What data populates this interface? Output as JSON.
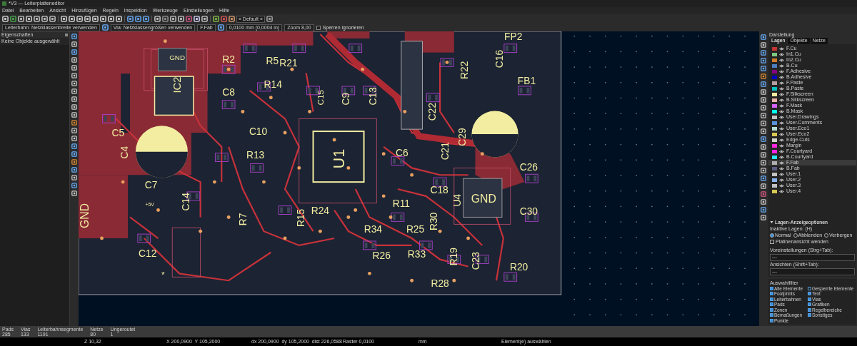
{
  "window": {
    "title": "*V3 — Leiterplatteneditor"
  },
  "menu": [
    "Datei",
    "Bearbeiten",
    "Ansicht",
    "Hinzufügen",
    "Regeln",
    "Inspektion",
    "Werkzeuge",
    "Einstellungen",
    "Hilfe"
  ],
  "toolbar": {
    "preset": "« Default »"
  },
  "toolbar2": {
    "track_width": "Leiterbahn: Netzklassenbreite verwenden",
    "via_size": "Via: Netzklassengrößen verwenden",
    "layer": "F.Fab",
    "grid": "0,0100 mm (0,0004 in)",
    "zoom": "Zoom 8,00",
    "ignore_locks": {
      "label": "Sperren ignorieren",
      "checked": false
    }
  },
  "properties_panel": {
    "title": "Eigenschaften",
    "message": "Keine Objekte ausgewählt"
  },
  "board": {
    "labels": [
      "GND",
      "R2",
      "R5",
      "R21",
      "IC2",
      "R14",
      "C8",
      "C5",
      "C4",
      "C7",
      "C10",
      "R13",
      "C14",
      "+5V",
      "C12",
      "R7",
      "R15",
      "R24",
      "U1",
      "C15",
      "C9",
      "C13",
      "R22",
      "C22",
      "C16",
      "FP2",
      "FB1",
      "C21",
      "C29",
      "C6",
      "C26",
      "C18",
      "R11",
      "U4",
      "GND",
      "C30",
      "R30",
      "R34",
      "R25",
      "R26",
      "R33",
      "R19",
      "C23",
      "R20",
      "R28",
      "GND",
      "*"
    ]
  },
  "appearance_panel": {
    "title": "Darstellung",
    "tabs": [
      {
        "label": "Lagen",
        "selected": true
      },
      {
        "label": "Objekte",
        "selected": false
      },
      {
        "label": "Netze",
        "selected": false
      }
    ],
    "layers": [
      {
        "name": "F.Cu",
        "color": "#c83434",
        "selected": false
      },
      {
        "name": "In1.Cu",
        "color": "#7fc87f",
        "selected": false
      },
      {
        "name": "In2.Cu",
        "color": "#ce7d2c",
        "selected": false
      },
      {
        "name": "B.Cu",
        "color": "#4d7fc4",
        "selected": false
      },
      {
        "name": "F.Adhesive",
        "color": "#840084",
        "selected": false
      },
      {
        "name": "B.Adhesive",
        "color": "#0000c2",
        "selected": false
      },
      {
        "name": "F.Paste",
        "color": "#b4a0a0",
        "selected": false
      },
      {
        "name": "B.Paste",
        "color": "#00c2c2",
        "selected": false
      },
      {
        "name": "F.Silkscreen",
        "color": "#f2eda1",
        "selected": false
      },
      {
        "name": "B.Silkscreen",
        "color": "#e8b2a7",
        "selected": false
      },
      {
        "name": "F.Mask",
        "color": "#d864ff",
        "selected": false
      },
      {
        "name": "B.Mask",
        "color": "#02ffee",
        "selected": false
      },
      {
        "name": "User.Drawings",
        "color": "#c2c2c2",
        "selected": false
      },
      {
        "name": "User.Comments",
        "color": "#5994dc",
        "selected": false
      },
      {
        "name": "User.Eco1",
        "color": "#b4dbd2",
        "selected": false
      },
      {
        "name": "User.Eco2",
        "color": "#d8c852",
        "selected": false
      },
      {
        "name": "Edge.Cuts",
        "color": "#d0d2cd",
        "selected": false
      },
      {
        "name": "Margin",
        "color": "#ff26e2",
        "selected": false
      },
      {
        "name": "F.Courtyard",
        "color": "#ff26e3",
        "selected": false
      },
      {
        "name": "B.Courtyard",
        "color": "#26e9ff",
        "selected": false
      },
      {
        "name": "F.Fab",
        "color": "#afafaf",
        "selected": true
      },
      {
        "name": "B.Fab",
        "color": "#585d84",
        "selected": false
      },
      {
        "name": "User.1",
        "color": "#c2c2c3",
        "selected": false
      },
      {
        "name": "User.2",
        "color": "#89b4f0",
        "selected": false
      },
      {
        "name": "User.3",
        "color": "#c2c2c4",
        "selected": false
      },
      {
        "name": "User.4",
        "color": "#d8c853",
        "selected": false
      }
    ],
    "layer_options": {
      "title": "Lagen-Anzeigeoptionen",
      "inactive_label": "Inaktive Lagen: (H)",
      "modes": [
        {
          "label": "Normal",
          "selected": true
        },
        {
          "label": "Abblenden",
          "selected": false
        },
        {
          "label": "Verbergen",
          "selected": false
        }
      ],
      "flip_board": {
        "label": "Platinenansicht wenden",
        "checked": false
      },
      "presets_label": "Voreinstellungen (Strg+Tab):",
      "presets_value": "---",
      "views_label": "Ansichten (Shift+Tab):",
      "views_value": "---"
    },
    "selection_filter": {
      "title": "Auswahlfilter",
      "items": [
        {
          "label": "Alle Elemente",
          "checked": true
        },
        {
          "label": "Gesperrte Elemente",
          "checked": false
        },
        {
          "label": "Footprints",
          "checked": true
        },
        {
          "label": "Text",
          "checked": true
        },
        {
          "label": "Leiterbahnen",
          "checked": true
        },
        {
          "label": "Vias",
          "checked": true
        },
        {
          "label": "Pads",
          "checked": true
        },
        {
          "label": "Grafiken",
          "checked": true
        },
        {
          "label": "Zonen",
          "checked": true
        },
        {
          "label": "Regelbereiche",
          "checked": true
        },
        {
          "label": "Bemaßungen",
          "checked": true
        },
        {
          "label": "Sonstiges",
          "checked": true
        },
        {
          "label": "Punkte",
          "checked": true
        }
      ]
    }
  },
  "message_panel": [
    {
      "label": "Pads",
      "value": "285"
    },
    {
      "label": "Vias",
      "value": "133"
    },
    {
      "label": "Leiterbahnsegmente",
      "value": "1191"
    },
    {
      "label": "Netze",
      "value": "80"
    },
    {
      "label": "Ungeroutet",
      "value": "1"
    }
  ],
  "status_bar": {
    "zoom": "Z 10,32",
    "position": "X 200,0900  Y 105,2000",
    "delta": "dx 200,0900  dy 105,2000  dist 226,0588",
    "grid": "Raster 0,0100",
    "units": "mm",
    "message": "Element(e) auswählen"
  }
}
